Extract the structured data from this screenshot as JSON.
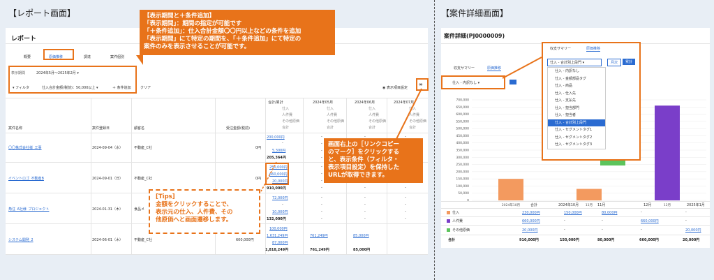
{
  "left_section": {
    "title": "【レポート画面】",
    "page_title": "レポート",
    "tabs": [
      "概要",
      "原価推移",
      "調達",
      "案件個別"
    ],
    "period_label": "表示期間",
    "period_value": "2024年5月～2025年2月",
    "filter_label": "フィルタ",
    "filter_chip": "仕入合計金額(税前)：50,000以上",
    "add_condition": "条件追加",
    "clear": "クリア",
    "display_settings": "表示項目設定",
    "col_headers": {
      "project": "案件名称",
      "contract_date": "案件登録日",
      "customer": "顧客名",
      "order_amount": "受注金額(税前)",
      "total": "合計/累計",
      "m1": "2024年05月",
      "m2": "2024年06月",
      "m3": "2024年07月"
    },
    "sub_headers": [
      "仕入",
      "人件費",
      "その他原価",
      "合計"
    ],
    "rows": [
      {
        "name": "〇〇株式会社様_工事",
        "date": "2024-09-04（水）",
        "customer": "不動産_C社",
        "order": "0円",
        "vals": [
          "200,000円",
          "-",
          "5,300円",
          "205,364円"
        ]
      },
      {
        "name": "イベントロゴ_不動産B",
        "date": "2024-09-01（日）",
        "customer": "不動産_C社",
        "order": "0円",
        "vals": [
          "250,000円",
          "660,000円",
          "20,000円",
          "910,000円"
        ]
      },
      {
        "name": "角注_A社様_プロジェクト",
        "date": "2024-01-31（木）",
        "customer": "食品メ",
        "order": "",
        "vals": [
          "72,000円",
          "-",
          "10,000円",
          "132,000円"
        ]
      },
      {
        "name": "システム開発_2",
        "date": "2024-06-01（木）",
        "customer": "不動産_C社",
        "order": "600,000円",
        "vals": [
          "100,000円",
          "1,631,249円",
          "87,000円",
          "1,818,249円"
        ]
      }
    ],
    "row4_extra": [
      "761,249円",
      "761,249円",
      "85,000円",
      "85,000円"
    ],
    "callout_top": [
      "【表示期間と＋条件追加】",
      "「表示期間」：期間の指定が可能です",
      "「＋条件追加」：仕入合計金額〇〇円以上などの条件を追加",
      "「表示期間」にて特定の期間を、「＋条件追加」にて特定の",
      "案件のみを表示させることが可能です。"
    ],
    "callout_right": [
      "画面右上の［リンクコピー",
      "のマーク］をクリックする",
      "と、表示条件（フィルタ・",
      "表示項目設定）を保持した",
      "URLが取得できます。"
    ],
    "tips": [
      "[Tips]",
      "金額をクリックすることで、",
      "表示元の仕入、人件費、その",
      "他原価へと画面遷移します。"
    ]
  },
  "right_section": {
    "title": "【案件詳細画面】",
    "detail_title": "案件詳細(PJ0000009)",
    "tabs": [
      "収支サマリー",
      "原価推移"
    ],
    "select_value": "仕入 - 内訳なし",
    "toggle": [
      "月次",
      "累計"
    ],
    "dropdown_selected": "仕入 - 合計別上段門",
    "dropdown_items": [
      "仕入 - 内訳なし",
      "仕入 - 金額部品タグ",
      "仕入 - 商品",
      "仕入 - 仕入先",
      "仕入 - 支払先",
      "仕入 - 担当部門",
      "仕入 - 担当者",
      "仕入 - 合計別上段門",
      "仕入 - セグメントタグ1",
      "仕入 - セグメントタグ2",
      "仕入 - セグメントタグ3"
    ],
    "y_ticks": [
      "700,000",
      "650,000",
      "600,000",
      "550,000",
      "500,000",
      "450,000",
      "400,000",
      "350,000",
      "300,000",
      "250,000",
      "200,000",
      "150,000",
      "100,000",
      "50,000",
      "0"
    ],
    "x_labels": [
      "2024年10月",
      "11月",
      "12月"
    ],
    "table_headers": [
      "合計",
      "2024年10月",
      "11月",
      "12月",
      "2025年1月"
    ],
    "table_rows": [
      {
        "label": "仕入",
        "color": "#f39a5f",
        "vals": [
          "230,000円",
          "150,000円",
          "80,000円",
          "-",
          "-"
        ]
      },
      {
        "label": "人件費",
        "color": "#7a3ec9",
        "vals": [
          "660,000円",
          "-",
          "-",
          "660,000円",
          "-"
        ]
      },
      {
        "label": "その他原価",
        "color": "#5cc45c",
        "vals": [
          "20,000円",
          "-",
          "-",
          "-",
          "20,000円"
        ]
      }
    ],
    "table_total": {
      "label": "合計",
      "vals": [
        "910,000円",
        "150,000円",
        "80,000円",
        "660,000円",
        "20,000円"
      ]
    }
  },
  "chart_data": {
    "type": "bar",
    "categories": [
      "2024年10月",
      "11月",
      "12月"
    ],
    "series": [
      {
        "name": "仕入",
        "values": [
          150000,
          80000,
          0
        ]
      },
      {
        "name": "人件費",
        "values": [
          0,
          0,
          660000
        ]
      },
      {
        "name": "その他原価",
        "values": [
          0,
          0,
          0
        ]
      }
    ],
    "ylim": [
      0,
      700000
    ],
    "colors": [
      "#f39a5f",
      "#7a3ec9",
      "#5cc45c"
    ]
  }
}
